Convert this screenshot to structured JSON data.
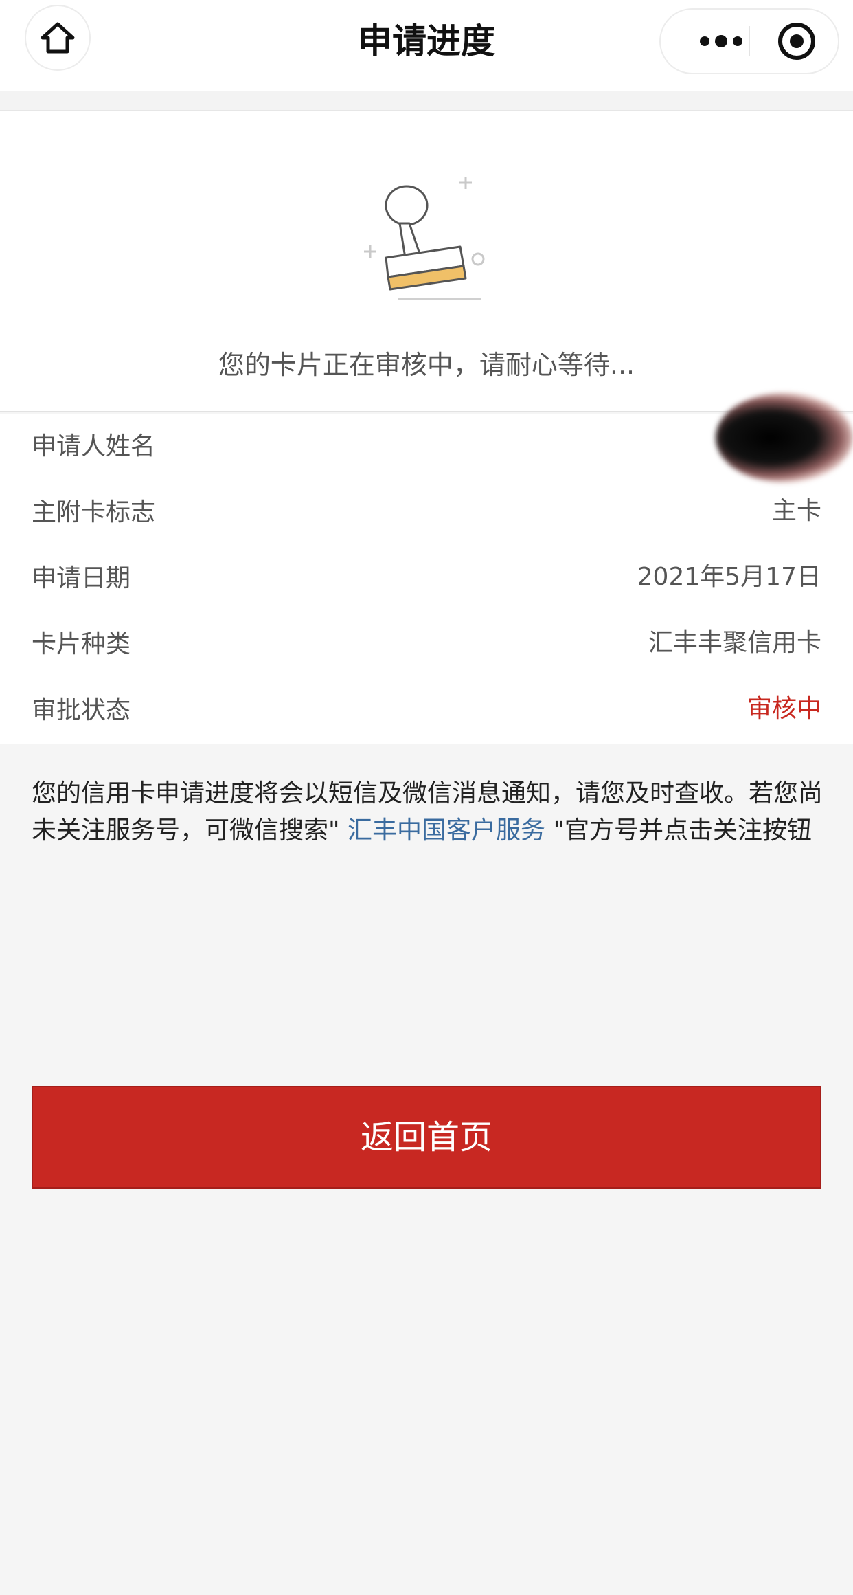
{
  "header": {
    "title": "申请进度",
    "home_icon": "home-icon",
    "more_icon": "more-dots-icon",
    "close_icon": "target-circle-icon"
  },
  "status": {
    "icon": "stamp-icon",
    "message": "您的卡片正在审核中，请耐心等待..."
  },
  "details": [
    {
      "label": "申请人姓名",
      "value": ""
    },
    {
      "label": "主附卡标志",
      "value": "主卡"
    },
    {
      "label": "申请日期",
      "value": "2021年5月17日"
    },
    {
      "label": "卡片种类",
      "value": "汇丰丰聚信用卡"
    },
    {
      "label": "审批状态",
      "value": "审核中"
    }
  ],
  "notice": {
    "line1": "您的信用卡申请进度将会以短信及微信消息通知，请您及时查收。若您尚",
    "line2_pre": "未关注服务号，可微信搜索\" ",
    "link": "汇丰中国客户服务",
    "line2_post": " \"官方号并点击关注按钮"
  },
  "actions": {
    "home_label": "返回首页"
  },
  "colors": {
    "accent_red": "#c82822",
    "link_blue": "#3a6b9f",
    "status_red": "#c8281f"
  }
}
